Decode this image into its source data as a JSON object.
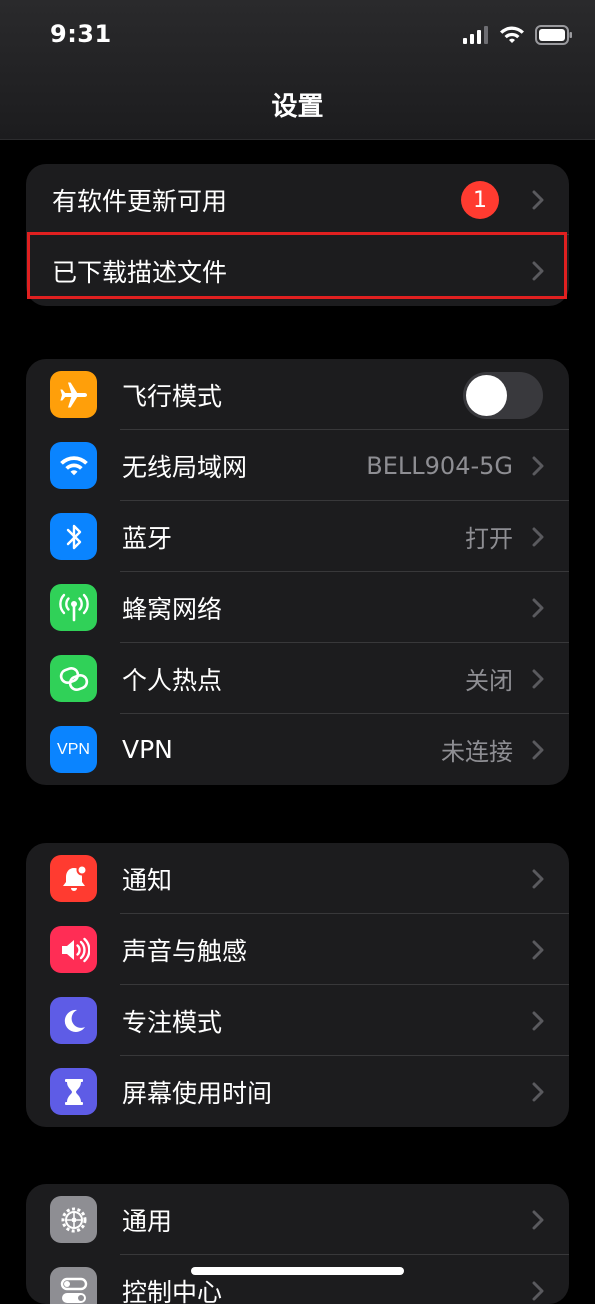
{
  "status_bar": {
    "time": "9:31"
  },
  "nav": {
    "title": "设置"
  },
  "group1": {
    "update": {
      "label": "有软件更新可用",
      "badge": "1"
    },
    "profile": {
      "label": "已下载描述文件"
    }
  },
  "group2": {
    "airplane": {
      "label": "飞行模式",
      "icon": "airplane-icon",
      "color": "#ff9f0a",
      "toggle_on": false
    },
    "wifi": {
      "label": "无线局域网",
      "value": "BELL904-5G",
      "icon": "wifi-icon",
      "color": "#0a84ff"
    },
    "bluetooth": {
      "label": "蓝牙",
      "value": "打开",
      "icon": "bluetooth-icon",
      "color": "#0a84ff"
    },
    "cellular": {
      "label": "蜂窝网络",
      "icon": "cellular-antenna-icon",
      "color": "#30d158"
    },
    "hotspot": {
      "label": "个人热点",
      "value": "关闭",
      "icon": "hotspot-link-icon",
      "color": "#30d158"
    },
    "vpn": {
      "label": "VPN",
      "value": "未连接",
      "icon_text": "VPN",
      "color": "#0a84ff"
    }
  },
  "group3": {
    "notifications": {
      "label": "通知",
      "icon": "bell-icon",
      "color": "#ff3b30"
    },
    "sounds": {
      "label": "声音与触感",
      "icon": "speaker-icon",
      "color": "#ff2d55"
    },
    "focus": {
      "label": "专注模式",
      "icon": "moon-icon",
      "color": "#5e5ce6"
    },
    "screentime": {
      "label": "屏幕使用时间",
      "icon": "hourglass-icon",
      "color": "#5e5ce6"
    }
  },
  "group4": {
    "general": {
      "label": "通用",
      "icon": "gear-icon",
      "color": "#8e8e93"
    },
    "control": {
      "label": "控制中心",
      "icon": "toggles-icon",
      "color": "#8e8e93"
    }
  },
  "colors": {
    "accent_red": "#ff3b30",
    "highlight_border": "#e02020",
    "background": "#000000",
    "cell": "#1c1c1e"
  }
}
